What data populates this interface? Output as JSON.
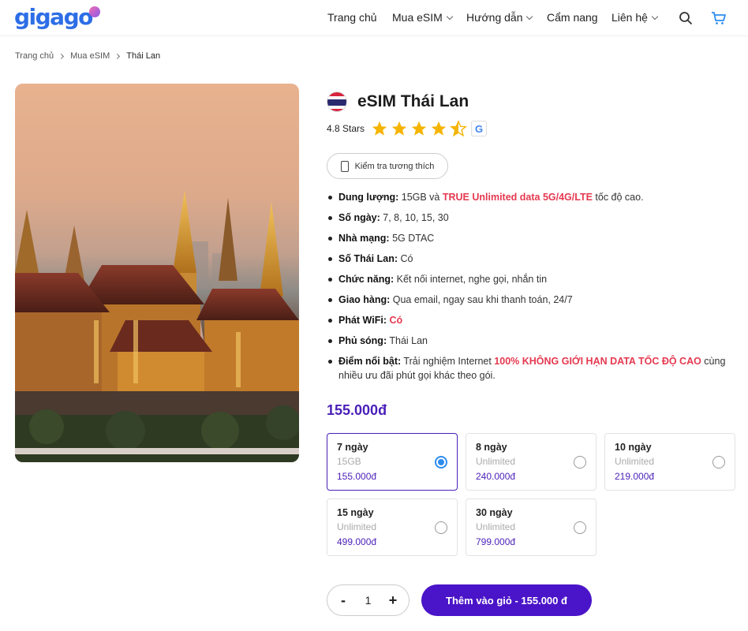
{
  "brand": {
    "logo_text": "gigago"
  },
  "nav": {
    "items": [
      {
        "label": "Trang chủ",
        "has_dropdown": false
      },
      {
        "label": "Mua eSIM",
        "has_dropdown": true
      },
      {
        "label": "Hướng dẫn",
        "has_dropdown": true
      },
      {
        "label": "Cẩm nang",
        "has_dropdown": false
      },
      {
        "label": "Liên hệ",
        "has_dropdown": true
      }
    ],
    "icons": [
      "search-icon",
      "cart-icon"
    ]
  },
  "breadcrumb": [
    "Trang chủ",
    "Mua eSIM",
    "Thái Lan"
  ],
  "product": {
    "title": "eSIM Thái Lan",
    "rating_text": "4.8 Stars",
    "rating_value": 4.5,
    "check_compat_label": "Kiểm tra tương thích",
    "features": [
      {
        "label": "Dung lượng:",
        "text": " 15GB và ",
        "highlight": "TRUE Unlimited data 5G/4G/LTE",
        "after": " tốc độ cao."
      },
      {
        "label": "Số ngày:",
        "text": " 7, 8, 10, 15, 30"
      },
      {
        "label": "Nhà mạng:",
        "text": " 5G DTAC"
      },
      {
        "label": "Số Thái Lan:",
        "text": " Có"
      },
      {
        "label": "Chức năng:",
        "text": " Kết nối internet, nghe gọi, nhắn tin"
      },
      {
        "label": "Giao hàng:",
        "text": " Qua email, ngay sau khi thanh toán, 24/7"
      },
      {
        "label": "Phát WiFi:",
        "text": " ",
        "highlight": "Có"
      },
      {
        "label": "Phủ sóng:",
        "text": " Thái Lan"
      },
      {
        "label": "Điểm nổi bật:",
        "text": " Trải nghiệm Internet ",
        "highlight": "100% KHÔNG GIỚI HẠN DATA TỐC ĐỘ CAO",
        "after": " cùng nhiều ưu đãi phút gọi khác theo gói."
      }
    ],
    "price": "155.000đ",
    "plans": [
      {
        "name": "7 ngày",
        "data": "15GB",
        "price": "155.000đ",
        "selected": true
      },
      {
        "name": "8 ngày",
        "data": "Unlimited",
        "price": "240.000đ",
        "selected": false
      },
      {
        "name": "10 ngày",
        "data": "Unlimited",
        "price": "219.000đ",
        "selected": false
      },
      {
        "name": "15 ngày",
        "data": "Unlimited",
        "price": "499.000đ",
        "selected": false
      },
      {
        "name": "30 ngày",
        "data": "Unlimited",
        "price": "799.000đ",
        "selected": false
      }
    ],
    "quantity": {
      "minus": "-",
      "value": "1",
      "plus": "+"
    },
    "add_to_cart_label": "Thêm vào giỏ - 155.000 đ"
  },
  "colors": {
    "brand": "#2d6ee6",
    "accent": "#4a14c8",
    "highlight": "#e53950",
    "radio": "#2d8cf0"
  }
}
